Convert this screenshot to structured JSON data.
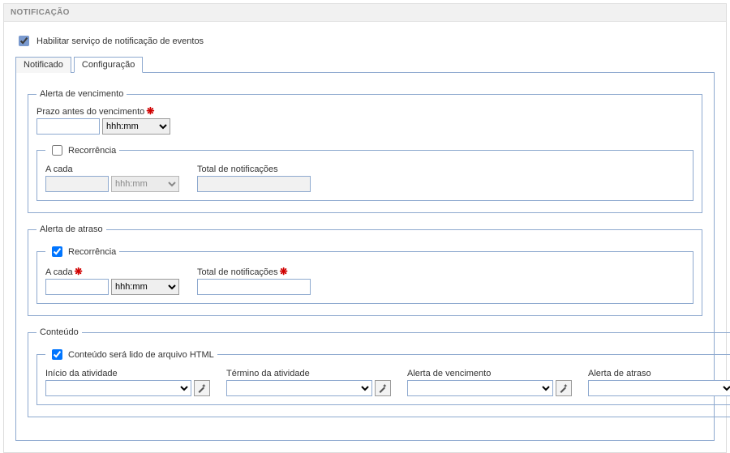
{
  "panel": {
    "title": "NOTIFICAÇÃO",
    "enable_label": "Habilitar serviço de notificação de eventos",
    "enable_checked": true
  },
  "tabs": {
    "notificado": {
      "label": "Notificado",
      "active": false
    },
    "configuracao": {
      "label": "Configuração",
      "active": true
    }
  },
  "venc": {
    "legend": "Alerta de vencimento",
    "prazo_label": "Prazo antes do vencimento",
    "prazo_value": "",
    "unit_option": "hhh:mm",
    "rec_legend": "Recorrência",
    "rec_checked": false,
    "acada_label": "A cada",
    "acada_value": "",
    "acada_unit": "hhh:mm",
    "total_label": "Total de notificações",
    "total_value": ""
  },
  "atraso": {
    "legend": "Alerta de atraso",
    "rec_legend": "Recorrência",
    "rec_checked": true,
    "acada_label": "A cada",
    "acada_value": "",
    "acada_unit": "hhh:mm",
    "total_label": "Total de notificações",
    "total_value": ""
  },
  "conteudo": {
    "legend": "Conteúdo",
    "arquivo_legend": "Conteúdo será lido de arquivo HTML",
    "arquivo_checked": true,
    "cols": {
      "inicio": {
        "label": "Início da atividade"
      },
      "termino": {
        "label": "Término da atividade"
      },
      "alerta_venc": {
        "label": "Alerta de vencimento"
      },
      "alerta_atraso": {
        "label": "Alerta de atraso"
      }
    }
  }
}
